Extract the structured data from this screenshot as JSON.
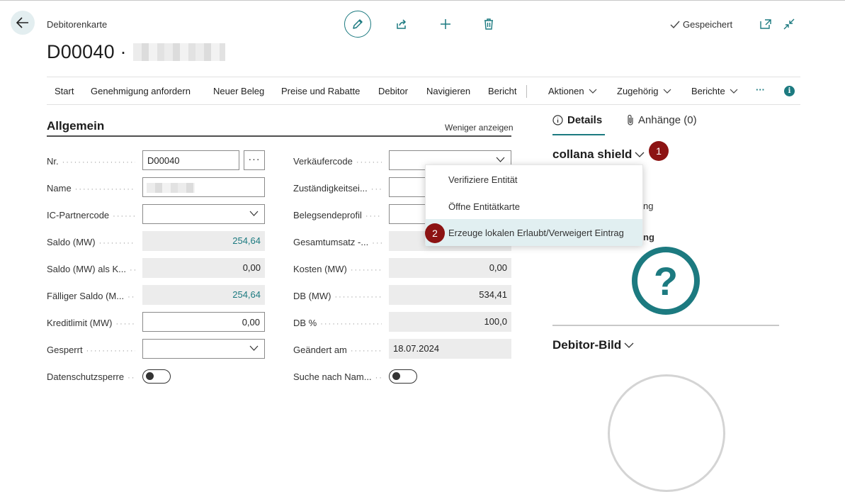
{
  "header": {
    "caption": "Debitorenkarte",
    "title": "D00040 ·",
    "saved_label": "Gespeichert"
  },
  "menu": {
    "items": [
      "Start",
      "Genehmigung anfordern",
      "Neuer Beleg",
      "Preise und Rabatte",
      "Debitor",
      "Navigieren",
      "Bericht"
    ],
    "dropdowns": [
      "Aktionen",
      "Zugehörig",
      "Berichte"
    ],
    "more": "···",
    "info": "i"
  },
  "section": {
    "title": "Allgemein",
    "less_link": "Weniger anzeigen"
  },
  "left_fields": {
    "nr": {
      "label": "Nr.",
      "value": "D00040",
      "button": "···"
    },
    "name": {
      "label": "Name"
    },
    "ic": {
      "label": "IC-Partnercode"
    },
    "saldo": {
      "label": "Saldo (MW)",
      "value": "254,64"
    },
    "saldo_als": {
      "label": "Saldo (MW) als K...",
      "value": "0,00"
    },
    "faellig": {
      "label": "Fälliger Saldo (M...",
      "value": "254,64"
    },
    "kreditlimit": {
      "label": "Kreditlimit (MW)",
      "value": "0,00"
    },
    "gesperrt": {
      "label": "Gesperrt"
    },
    "datenschutz": {
      "label": "Datenschutzsperre"
    }
  },
  "right_fields": {
    "verkaeufer": {
      "label": "Verkäufercode"
    },
    "zustaendig": {
      "label": "Zuständigkeitsei..."
    },
    "belegsende": {
      "label": "Belegsendeprofil"
    },
    "gesamtumsatz": {
      "label": "Gesamtumsatz -..."
    },
    "kosten": {
      "label": "Kosten (MW)",
      "value": "0,00"
    },
    "db": {
      "label": "DB (MW)",
      "value": "534,41"
    },
    "db_pct": {
      "label": "DB %",
      "value": "100,0"
    },
    "geaendert": {
      "label": "Geändert am",
      "value": "18.07.2024"
    },
    "suche": {
      "label": "Suche nach Nam..."
    }
  },
  "factbox": {
    "tab_details": "Details",
    "tab_attachments": "Anhänge (0)",
    "title": "collana shield",
    "partial_1": "ng",
    "partial_2": "ng",
    "qmark": "?",
    "picture_title": "Debitor-Bild"
  },
  "context_menu": {
    "items": [
      "Verifiziere Entität",
      "Öffne Entitätkarte",
      "Erzeuge lokalen Erlaubt/Verweigert Eintrag"
    ]
  },
  "badges": {
    "one": "1",
    "two": "2"
  },
  "colors": {
    "accent": "#1c7a80",
    "badge": "#8c1313",
    "highlight": "#e1eff1"
  }
}
